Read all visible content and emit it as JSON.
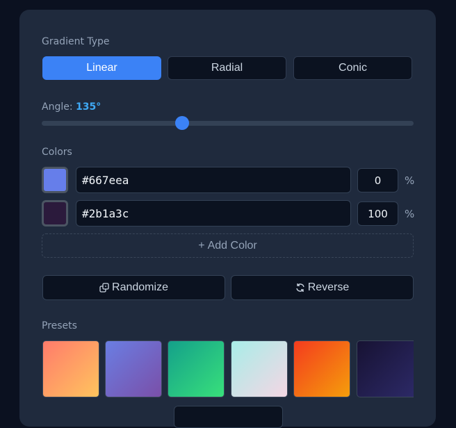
{
  "gradient_type": {
    "label": "Gradient Type",
    "options": [
      "Linear",
      "Radial",
      "Conic"
    ],
    "selected": "Linear"
  },
  "angle": {
    "label": "Angle:",
    "value_text": "135°",
    "value": 135,
    "max": 360
  },
  "colors": {
    "label": "Colors",
    "stops": [
      {
        "hex": "#667eea",
        "percent": "0",
        "unit": "%",
        "swatch": "#667eea"
      },
      {
        "hex": "#2b1a3c",
        "percent": "100",
        "unit": "%",
        "swatch": "#2b1a3c"
      }
    ],
    "add_label": "Add Color",
    "add_icon": "+"
  },
  "actions": {
    "randomize_label": "Randomize",
    "randomize_icon": "dice-icon",
    "reverse_label": "Reverse",
    "reverse_icon": "refresh-icon"
  },
  "presets": {
    "label": "Presets",
    "items": [
      {
        "from": "#ff7b6b",
        "to": "#ffc45e"
      },
      {
        "from": "#6a7ee3",
        "to": "#7a4fa8"
      },
      {
        "from": "#14a08a",
        "to": "#38e07b"
      },
      {
        "from": "#a8ede8",
        "to": "#f4d6e4"
      },
      {
        "from": "#f43b1e",
        "to": "#f59e0b"
      },
      {
        "from": "#171233",
        "to": "#2c2966"
      }
    ]
  }
}
